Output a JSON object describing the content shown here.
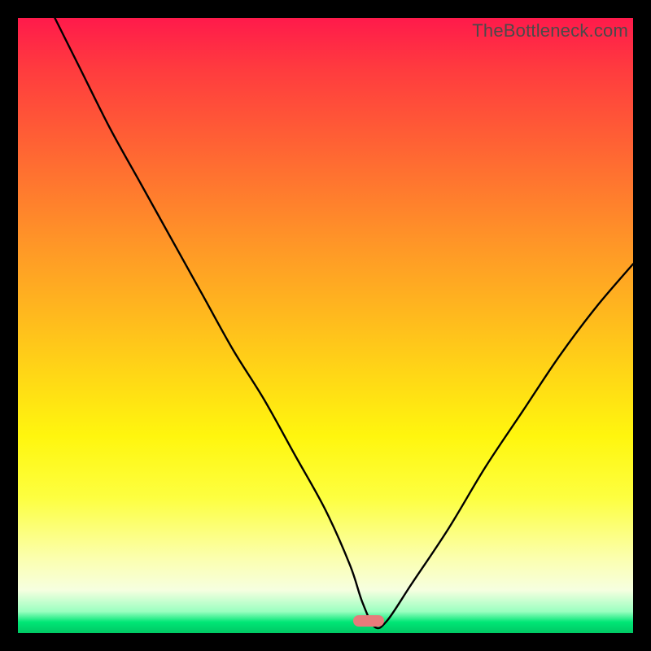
{
  "watermark": "TheBottleneck.com",
  "chart_data": {
    "type": "line",
    "title": "",
    "xlabel": "",
    "ylabel": "",
    "xlim": [
      0,
      100
    ],
    "ylim": [
      0,
      100
    ],
    "x": [
      6,
      10,
      15,
      20,
      25,
      30,
      35,
      40,
      45,
      50,
      54,
      56,
      58,
      60,
      64,
      70,
      76,
      82,
      88,
      94,
      100
    ],
    "values": [
      100,
      92,
      82,
      73,
      64,
      55,
      46,
      38,
      29,
      20,
      11,
      5,
      1,
      2,
      8,
      17,
      27,
      36,
      45,
      53,
      60
    ],
    "optimal_x": 57,
    "optimal_y": 2,
    "gradient_note": "vertical rainbow red→green",
    "grid": false,
    "legend": false
  },
  "colors": {
    "curve": "#000000",
    "marker": "#e77b7b",
    "frame": "#000000"
  }
}
